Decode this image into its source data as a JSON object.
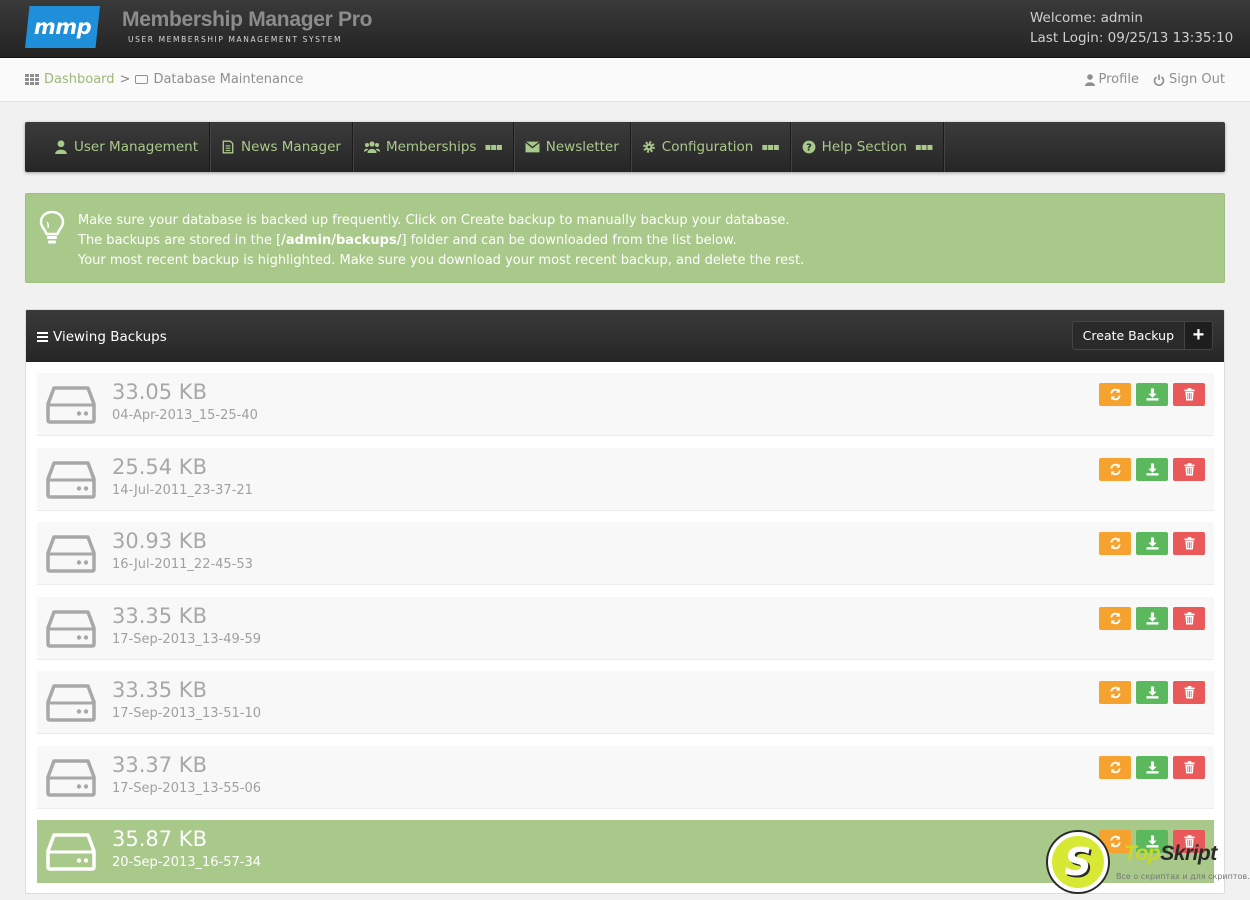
{
  "header": {
    "logo": "mmp",
    "title": "Membership Manager Pro",
    "subtitle": "USER MEMBERSHIP MANAGEMENT SYSTEM",
    "welcome": "Welcome: admin",
    "last_login": "Last Login: 09/25/13 13:35:10"
  },
  "breadcrumb": {
    "home": "Dashboard",
    "separator": ">",
    "current": "Database Maintenance"
  },
  "top_links": {
    "profile": "Profile",
    "sign_out": "Sign Out"
  },
  "nav": {
    "items": [
      {
        "label": "User Management",
        "icon": "user-icon",
        "has_menu": false
      },
      {
        "label": "News Manager",
        "icon": "document-icon",
        "has_menu": false
      },
      {
        "label": "Memberships",
        "icon": "users-icon",
        "has_menu": true
      },
      {
        "label": "Newsletter",
        "icon": "envelope-icon",
        "has_menu": false
      },
      {
        "label": "Configuration",
        "icon": "gear-icon",
        "has_menu": true
      },
      {
        "label": "Help Section",
        "icon": "question-icon",
        "has_menu": true
      }
    ]
  },
  "alert": {
    "line1": "Make sure your database is backed up frequently. Click on Create backup to manually backup your database.",
    "line2_pre": "The backups are stored in the [",
    "line2_path": "/admin/backups/",
    "line2_post": "] folder and can be downloaded from the list below.",
    "line3": "Your most recent backup is highlighted. Make sure you download your most recent backup, and delete the rest."
  },
  "panel": {
    "title": "Viewing Backups",
    "create_label": "Create Backup",
    "create_symbol": "+"
  },
  "backups": [
    {
      "size": "33.05 KB",
      "date": "04-Apr-2013_15-25-40",
      "latest": false
    },
    {
      "size": "25.54 KB",
      "date": "14-Jul-2011_23-37-21",
      "latest": false
    },
    {
      "size": "30.93 KB",
      "date": "16-Jul-2011_22-45-53",
      "latest": false
    },
    {
      "size": "33.35 KB",
      "date": "17-Sep-2013_13-49-59",
      "latest": false
    },
    {
      "size": "33.35 KB",
      "date": "17-Sep-2013_13-51-10",
      "latest": false
    },
    {
      "size": "33.37 KB",
      "date": "17-Sep-2013_13-55-06",
      "latest": false
    },
    {
      "size": "35.87 KB",
      "date": "20-Sep-2013_16-57-34",
      "latest": true
    }
  ],
  "colors": {
    "accent_green": "#a9c98a",
    "restore": "#f5a22e",
    "download": "#5cb85c",
    "delete": "#e9595a",
    "logo_blue": "#1e8fd8"
  },
  "watermark": {
    "badge": "S",
    "name_a": "Top",
    "name_b": "Skript",
    "tagline": "Все о скриптах и для скриптов..."
  }
}
